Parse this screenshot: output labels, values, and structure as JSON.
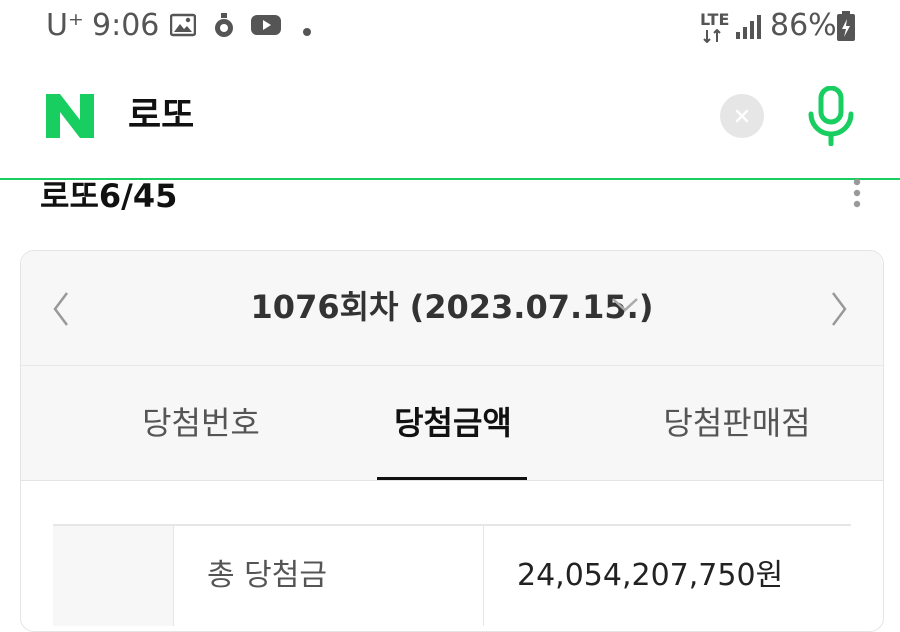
{
  "status_bar": {
    "carrier": "U⁺",
    "time": "9:06",
    "network": "LTE",
    "battery": "86%"
  },
  "search": {
    "logo_letter": "N",
    "query": "로또"
  },
  "lotto": {
    "title": "로또6/45",
    "round_label": "1076회차 (2023.07.15.)",
    "tabs": [
      "당첨번호",
      "당첨금액",
      "당첨판매점"
    ],
    "active_tab": "당첨금액",
    "table": {
      "total_label": "총 당첨금",
      "total_value": "24,054,207,750원"
    }
  },
  "colors": {
    "naver_green": "#19ce60",
    "mic_green": "#19ce60"
  }
}
